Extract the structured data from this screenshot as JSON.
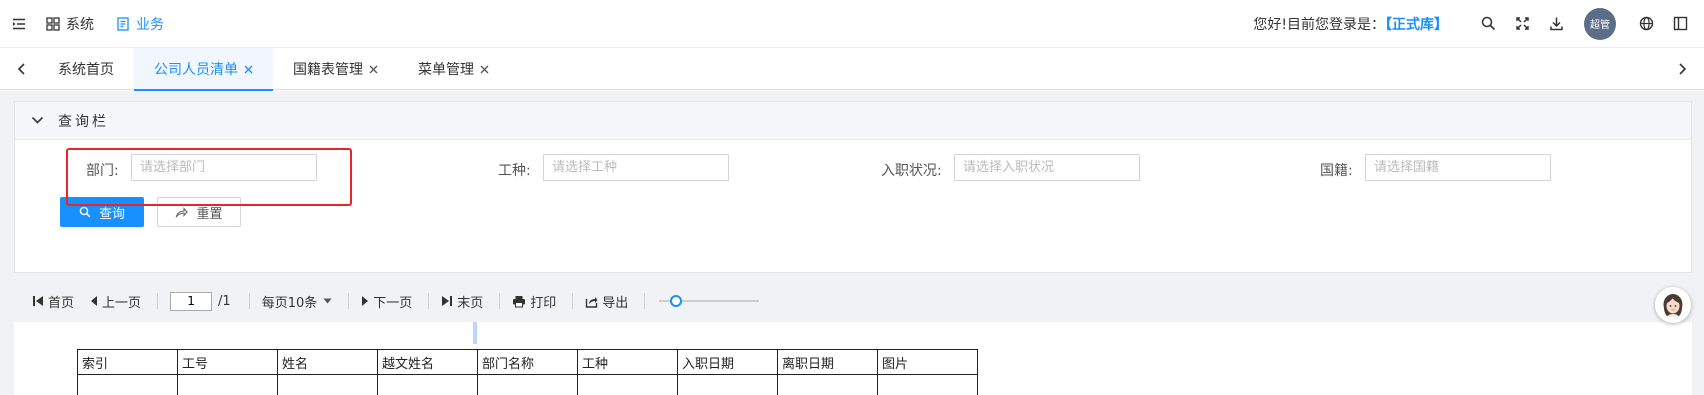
{
  "header": {
    "nav": [
      {
        "label": "系统",
        "icon": "grid-icon",
        "active": false
      },
      {
        "label": "业务",
        "icon": "document-icon",
        "active": true
      }
    ],
    "greeting": "您好!目前您登录是：",
    "database": "【正式库】",
    "avatar_text": "超管",
    "icons": [
      "search-icon",
      "fullscreen-icon",
      "download-icon",
      "globe-icon",
      "layout-icon"
    ]
  },
  "tabs": {
    "items": [
      {
        "label": "系统首页",
        "closable": false,
        "active": false
      },
      {
        "label": "公司人员清单",
        "closable": true,
        "active": true
      },
      {
        "label": "国籍表管理",
        "closable": true,
        "active": false
      },
      {
        "label": "菜单管理",
        "closable": true,
        "active": false
      }
    ]
  },
  "query": {
    "title": "查询栏",
    "fields": [
      {
        "label": "部门:",
        "placeholder": "请选择部门"
      },
      {
        "label": "工种:",
        "placeholder": "请选择工种"
      },
      {
        "label": "入职状况:",
        "placeholder": "请选择入职状况"
      },
      {
        "label": "国籍:",
        "placeholder": "请选择国籍"
      }
    ],
    "search_label": "查询",
    "reset_label": "重置"
  },
  "pager": {
    "first": "首页",
    "prev": "上一页",
    "current_page": "1",
    "total_pages": "/1",
    "page_size": "每页10条",
    "next": "下一页",
    "last": "末页",
    "print": "打印",
    "export": "导出",
    "zoom_level": 0.12
  },
  "report": {
    "columns": [
      "索引",
      "工号",
      "姓名",
      "越文姓名",
      "部门名称",
      "工种",
      "入职日期",
      "离职日期",
      "图片"
    ]
  },
  "colors": {
    "accent": "#1890ff",
    "highlight": "#e8262a"
  }
}
